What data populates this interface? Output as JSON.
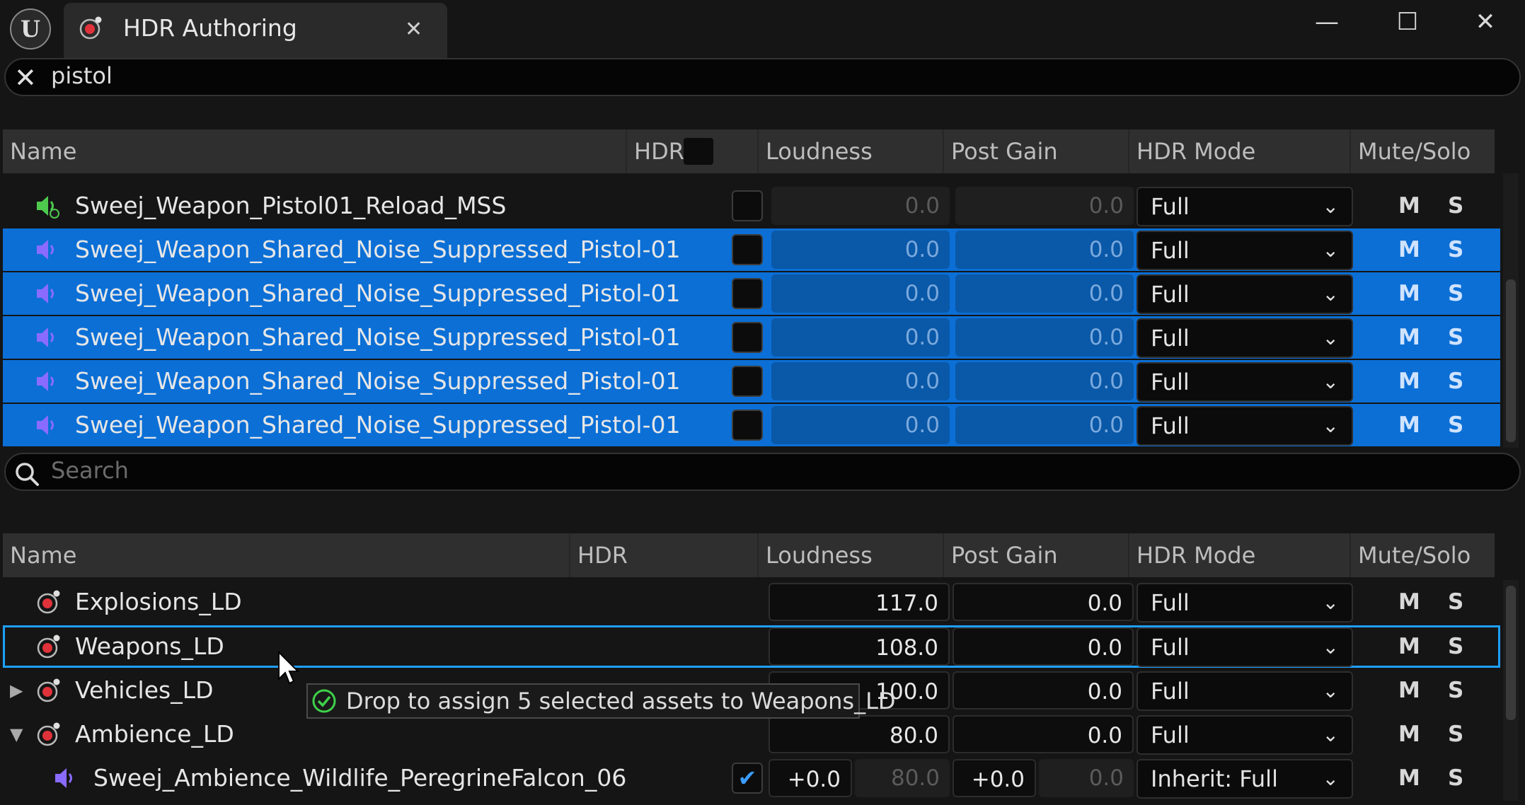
{
  "window": {
    "tab_title": "HDR Authoring",
    "close_tab_glyph": "✕",
    "minimize_glyph": "—",
    "maximize_glyph": "☐",
    "close_glyph": "✕"
  },
  "top_search": {
    "value": "pistol",
    "clear_glyph": "✕"
  },
  "top_table": {
    "headers": {
      "name": "Name",
      "hdr": "HDR",
      "loudness": "Loudness",
      "post_gain": "Post Gain",
      "hdr_mode": "HDR Mode",
      "mute_solo": "Mute/Solo"
    },
    "rows": [
      {
        "name": "Sweej_Weapon_Pistol01_Reload_MSS",
        "loudness": "0.0",
        "post_gain": "0.0",
        "mode": "Full",
        "m": "M",
        "s": "S",
        "selected": false
      },
      {
        "name": "Sweej_Weapon_Shared_Noise_Suppressed_Pistol-01",
        "loudness": "0.0",
        "post_gain": "0.0",
        "mode": "Full",
        "m": "M",
        "s": "S",
        "selected": true
      },
      {
        "name": "Sweej_Weapon_Shared_Noise_Suppressed_Pistol-01",
        "loudness": "0.0",
        "post_gain": "0.0",
        "mode": "Full",
        "m": "M",
        "s": "S",
        "selected": true
      },
      {
        "name": "Sweej_Weapon_Shared_Noise_Suppressed_Pistol-01",
        "loudness": "0.0",
        "post_gain": "0.0",
        "mode": "Full",
        "m": "M",
        "s": "S",
        "selected": true
      },
      {
        "name": "Sweej_Weapon_Shared_Noise_Suppressed_Pistol-01",
        "loudness": "0.0",
        "post_gain": "0.0",
        "mode": "Full",
        "m": "M",
        "s": "S",
        "selected": true
      },
      {
        "name": "Sweej_Weapon_Shared_Noise_Suppressed_Pistol-01",
        "loudness": "0.0",
        "post_gain": "0.0",
        "mode": "Full",
        "m": "M",
        "s": "S",
        "selected": true
      }
    ]
  },
  "bottom_search": {
    "placeholder": "Search"
  },
  "bottom_table": {
    "headers": {
      "name": "Name",
      "hdr": "HDR",
      "loudness": "Loudness",
      "post_gain": "Post Gain",
      "hdr_mode": "HDR Mode",
      "mute_solo": "Mute/Solo"
    },
    "rows": [
      {
        "name": "Explosions_LD",
        "loudness": "117.0",
        "post_gain": "0.0",
        "mode": "Full",
        "m": "M",
        "s": "S"
      },
      {
        "name": "Weapons_LD",
        "loudness": "108.0",
        "post_gain": "0.0",
        "mode": "Full",
        "m": "M",
        "s": "S"
      },
      {
        "name": "Vehicles_LD",
        "loudness": "100.0",
        "post_gain": "0.0",
        "mode": "Full",
        "m": "M",
        "s": "S",
        "expander": "▶"
      },
      {
        "name": "Ambience_LD",
        "loudness": "80.0",
        "post_gain": "0.0",
        "mode": "Full",
        "m": "M",
        "s": "S",
        "expander": "▼"
      },
      {
        "name": "Sweej_Ambience_Wildlife_PeregrineFalcon_06",
        "loudness_offset": "+0.0",
        "loudness": "80.0",
        "post_gain_offset": "+0.0",
        "post_gain": "0.0",
        "mode": "Inherit: Full",
        "m": "M",
        "s": "S",
        "hdr_checked": "✔"
      }
    ]
  },
  "tooltip": {
    "text": "Drop to assign 5 selected assets to Weapons_LD"
  },
  "colors": {
    "selection": "#0b6fd6",
    "focus_outline": "#1ea0ff",
    "speaker_purple": "#8a6bff",
    "speaker_green": "#4ec94e",
    "bus_red": "#e0323a"
  }
}
